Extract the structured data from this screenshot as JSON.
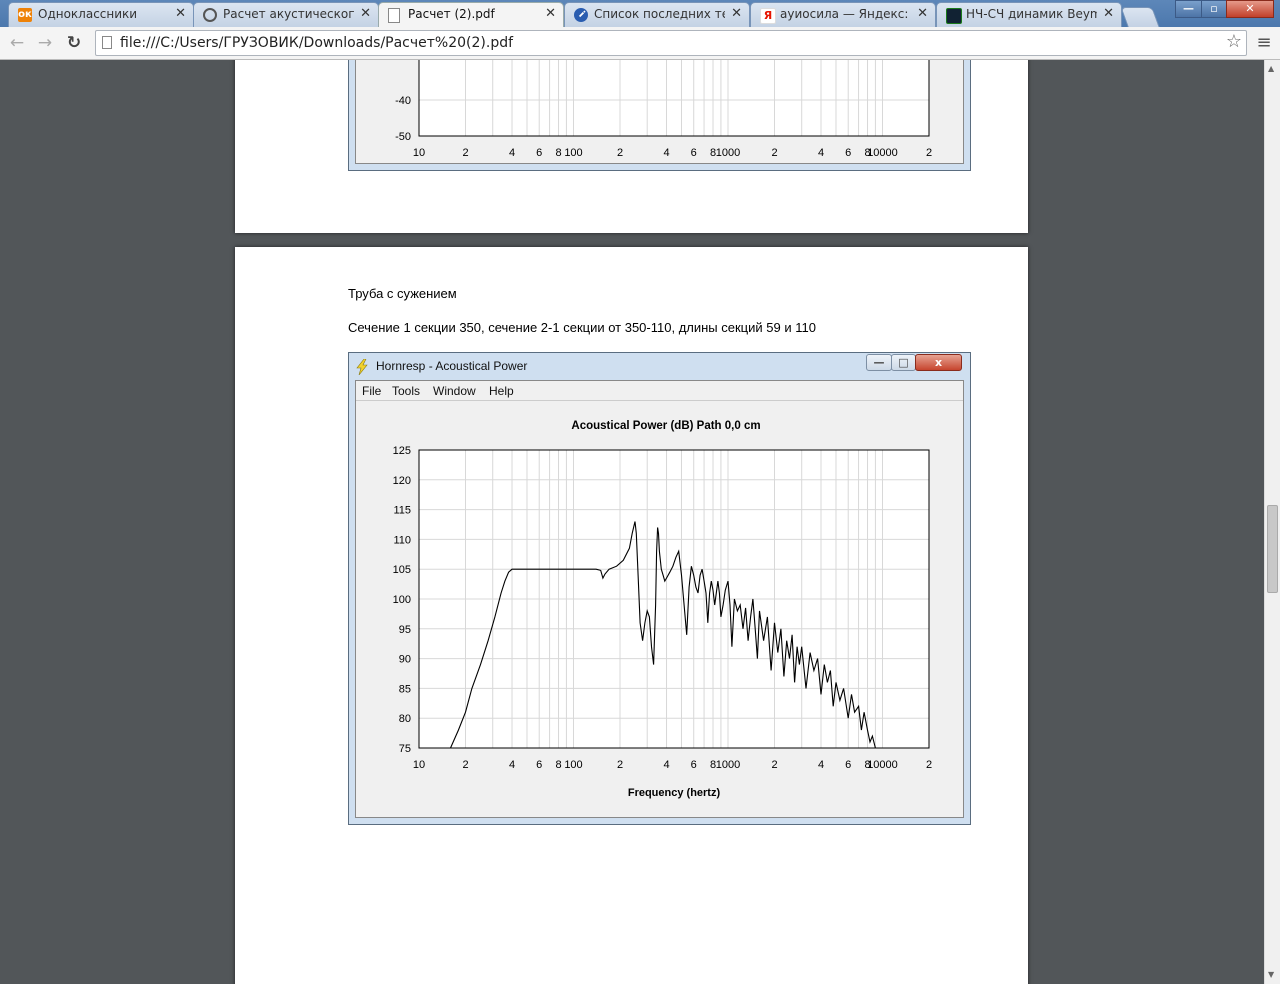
{
  "tabs": [
    {
      "label": "Одноклассники",
      "icon": "odnoklassniki-icon",
      "color": "#ee8208"
    },
    {
      "label": "Расчет акустического о",
      "icon": "forum-icon",
      "color": "#555555"
    },
    {
      "label": "Расчет (2).pdf",
      "icon": "document-icon",
      "color": "#ffffff"
    },
    {
      "label": "Список последних тем,",
      "icon": "info-icon",
      "color": "#2a5db0"
    },
    {
      "label": "ауиосила — Яндекс: на",
      "icon": "yandex-icon",
      "color": "#e61400"
    },
    {
      "label": "НЧ-СЧ динамик Beyma",
      "icon": "equalizer-icon",
      "color": "#1a7a1a"
    }
  ],
  "window_controls": {
    "minimize": "—",
    "maximize": "▫",
    "close": "✕"
  },
  "toolbar": {
    "back": "←",
    "forward": "→",
    "reload": "↻",
    "url": "file:///C:/Users/ГРУЗОВИК/Downloads/Расчет%20(2).pdf",
    "star": "☆",
    "menu": "≡"
  },
  "page2": {
    "heading": "Труба с сужением",
    "description": "Сечение 1 секции 350, сечение 2-1 секции от 350-110, длины секций 59 и 110"
  },
  "hornresp": {
    "title": "Hornresp - Acoustical Power",
    "menu": [
      "File",
      "Tools",
      "Window",
      "Help"
    ],
    "buttons": {
      "minimize": "—",
      "maximize": "□",
      "close": "x"
    }
  },
  "chart_data": [
    {
      "type": "line",
      "title": "",
      "xlabel": "Frequency (hertz)",
      "x_tick_labels": [
        "10",
        "2",
        "4",
        "6",
        "8",
        "100",
        "2",
        "4",
        "6",
        "8",
        "1000",
        "2",
        "4",
        "6",
        "8",
        "10000",
        "2"
      ],
      "y_tick_labels": [
        "-40",
        "-50"
      ],
      "xscale": "log",
      "grid": true,
      "series": []
    },
    {
      "type": "line",
      "title": "Acoustical Power (dB)   Path 0,0 cm",
      "xlabel": "Frequency (hertz)",
      "ylabel": "",
      "xscale": "log",
      "xlim": [
        10,
        20000
      ],
      "ylim": [
        75,
        125
      ],
      "y_tick_labels": [
        "125",
        "120",
        "115",
        "110",
        "105",
        "100",
        "95",
        "90",
        "85",
        "80",
        "75"
      ],
      "x_tick_labels": [
        "10",
        "2",
        "4",
        "6",
        "8",
        "100",
        "2",
        "4",
        "6",
        "8",
        "1000",
        "2",
        "4",
        "6",
        "8",
        "10000",
        "2"
      ],
      "grid": true,
      "line_color": "#000000",
      "series": [
        {
          "x": [
            16,
            18,
            20,
            22,
            25,
            28,
            31,
            34,
            36,
            38,
            40,
            45,
            50,
            60,
            80,
            100,
            120,
            140,
            150,
            155,
            160,
            170,
            190,
            210,
            230,
            240,
            250,
            255,
            262,
            270,
            280,
            290,
            300,
            310,
            320,
            330,
            340,
            345,
            350,
            355,
            360,
            370,
            380,
            390,
            400,
            420,
            440,
            460,
            480,
            500,
            520,
            540,
            560,
            580,
            600,
            620,
            640,
            660,
            680,
            700,
            720,
            740,
            760,
            780,
            800,
            820,
            840,
            860,
            880,
            900,
            930,
            960,
            1000,
            1030,
            1060,
            1100,
            1150,
            1200,
            1250,
            1300,
            1350,
            1400,
            1450,
            1500,
            1550,
            1600,
            1700,
            1800,
            1900,
            2000,
            2100,
            2200,
            2300,
            2400,
            2500,
            2600,
            2700,
            2800,
            2900,
            3000,
            3200,
            3400,
            3600,
            3800,
            4000,
            4200,
            4400,
            4600,
            4800,
            5000,
            5300,
            5600,
            6000,
            6300,
            6600,
            7000,
            7300,
            7600,
            8000,
            8300,
            8600,
            9000
          ],
          "y": [
            75,
            78,
            81,
            85,
            89,
            93,
            97,
            101,
            103,
            104.5,
            105,
            105,
            105,
            105,
            105,
            105,
            105,
            105,
            104.8,
            103.5,
            104.2,
            105,
            105.5,
            106.5,
            108.5,
            111,
            113,
            111,
            104,
            96,
            93,
            96,
            98,
            97,
            92,
            89,
            99,
            108,
            112,
            111,
            108,
            105,
            104,
            103,
            103.5,
            104.5,
            105.5,
            107,
            108,
            104,
            99,
            94,
            102,
            105.5,
            104,
            102,
            101,
            104,
            105,
            103,
            101,
            96,
            101,
            103,
            101.5,
            99,
            101,
            103,
            101,
            97,
            99,
            101.5,
            103,
            99,
            92,
            100,
            98,
            99,
            95,
            98.5,
            93,
            97,
            100,
            95,
            90,
            98,
            93,
            97,
            88,
            96,
            91,
            95,
            87,
            93,
            90,
            94,
            86,
            92,
            89,
            92,
            85,
            91,
            88,
            90,
            84,
            89,
            86,
            88,
            82,
            86,
            83,
            85,
            80,
            84,
            81,
            82,
            78,
            81,
            78,
            76,
            77,
            75
          ]
        }
      ]
    }
  ]
}
